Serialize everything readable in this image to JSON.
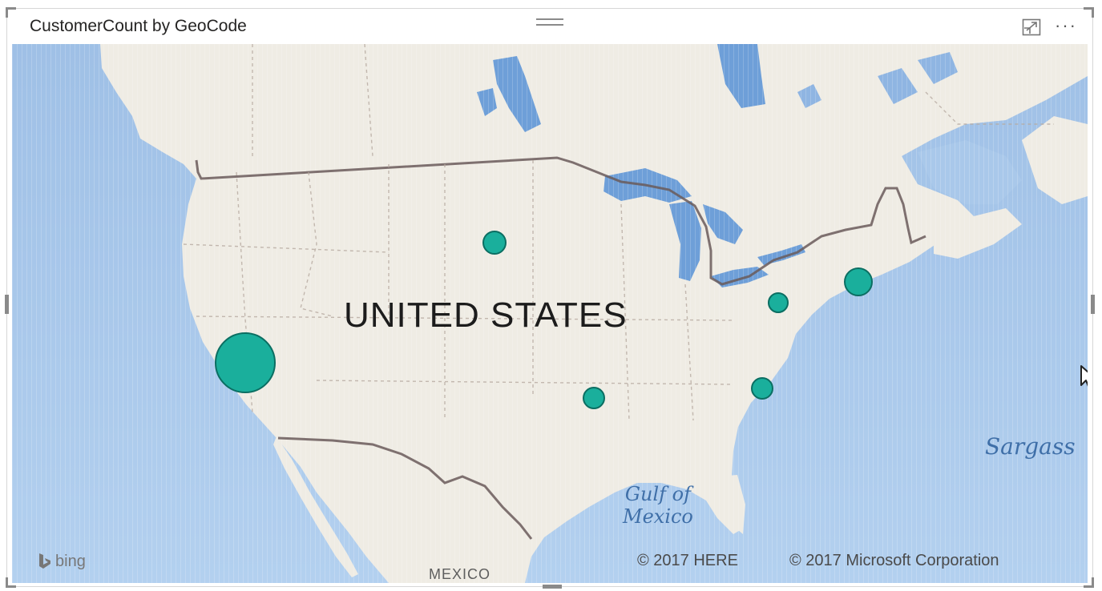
{
  "visual": {
    "title": "CustomerCount by GeoCode",
    "focus_mode_icon": "focus-mode-icon",
    "more_options_label": "···"
  },
  "map": {
    "country_label": "UNITED STATES",
    "neighbor_label": "MEXICO",
    "sea_labels": {
      "sargasso": "Sargass",
      "gulf_line1": "Gulf of",
      "gulf_line2": "Mexico"
    },
    "bing_label": "bing",
    "copyright_here": "© 2017 HERE",
    "copyright_microsoft": "© 2017 Microsoft Corporation"
  },
  "colors": {
    "bubble_fill": "#1aaf9c",
    "bubble_stroke": "#0b6e62",
    "land": "#efece4",
    "water": "#a9c8ea"
  }
}
